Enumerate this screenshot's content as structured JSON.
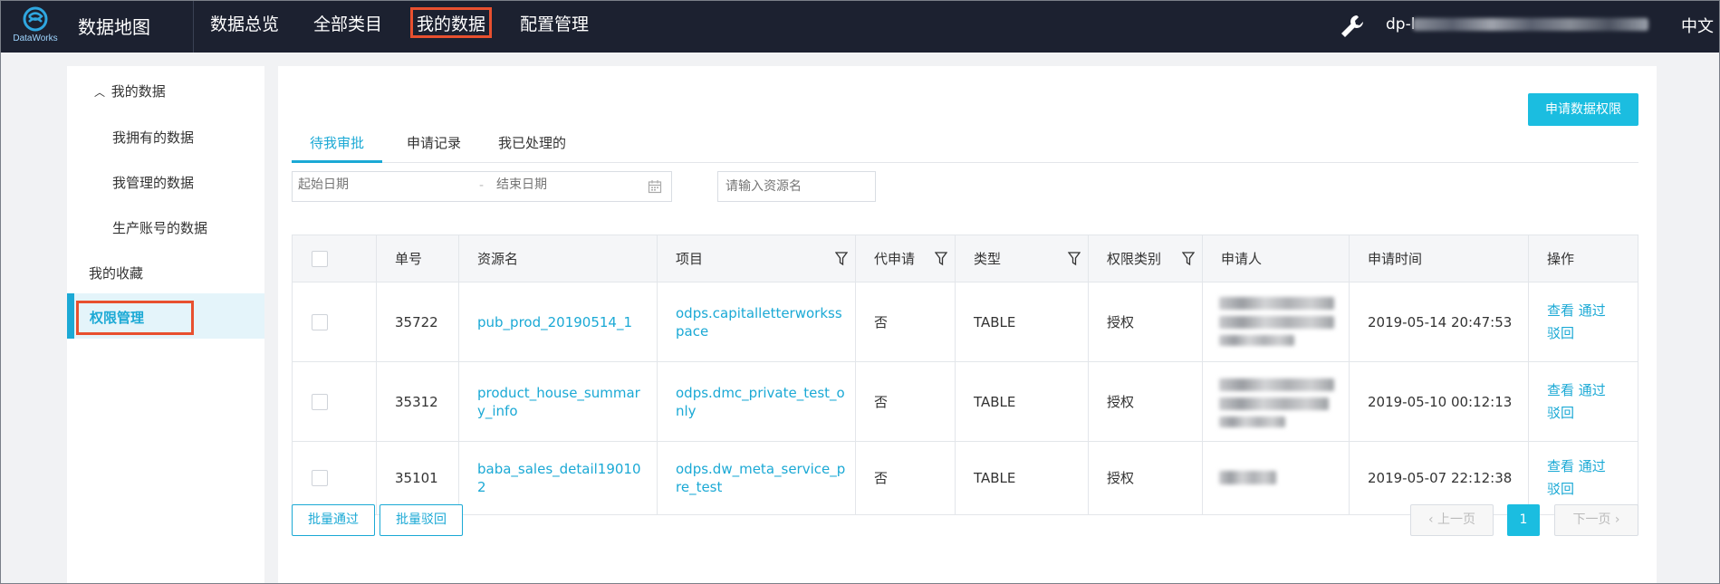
{
  "header": {
    "logo_text": "DataWorks",
    "app_title": "数据地图",
    "nav": [
      "数据总览",
      "全部类目",
      "我的数据",
      "配置管理"
    ],
    "highlighted_nav_index": 2,
    "user_prefix": "dp-l",
    "language": "中文"
  },
  "sidebar": {
    "group_label": "我的数据",
    "sub_items": [
      "我拥有的数据",
      "我管理的数据",
      "生产账号的数据"
    ],
    "favorites": "我的收藏",
    "permission": "权限管理"
  },
  "main": {
    "apply_button": "申请数据权限",
    "tabs": [
      "待我审批",
      "申请记录",
      "我已处理的"
    ],
    "active_tab_index": 0,
    "date_start_placeholder": "起始日期",
    "date_separator": "-",
    "date_end_placeholder": "结束日期",
    "resource_placeholder": "请输入资源名",
    "columns": [
      "单号",
      "资源名",
      "项目",
      "代申请",
      "类型",
      "权限类别",
      "申请人",
      "申请时间",
      "操作"
    ],
    "rows": [
      {
        "id": "35722",
        "resource": "pub_prod_20190514_1",
        "project": "odps.capitalletterworksspace",
        "proxy": "否",
        "type": "TABLE",
        "perm": "授权",
        "time": "2019-05-14 20:47:53",
        "op_view": "查看",
        "op_pass": "通过",
        "op_reject": "驳回"
      },
      {
        "id": "35312",
        "resource": "product_house_summary_info",
        "project": "odps.dmc_private_test_only",
        "proxy": "否",
        "type": "TABLE",
        "perm": "授权",
        "time": "2019-05-10 00:12:13",
        "op_view": "查看",
        "op_pass": "通过",
        "op_reject": "驳回"
      },
      {
        "id": "35101",
        "resource": "baba_sales_detail190102",
        "project": "odps.dw_meta_service_pre_test",
        "proxy": "否",
        "type": "TABLE",
        "perm": "授权",
        "time": "2019-05-07 22:12:38",
        "op_view": "查看",
        "op_pass": "通过",
        "op_reject": "驳回"
      }
    ],
    "batch_pass": "批量通过",
    "batch_reject": "批量驳回",
    "prev_page": "上一页",
    "next_page": "下一页",
    "current_page": "1"
  },
  "colors": {
    "header_bg": "#1c2130",
    "accent": "#1ba9d5",
    "primary_button": "#1bbde0",
    "highlight_box": "#e8502f"
  }
}
